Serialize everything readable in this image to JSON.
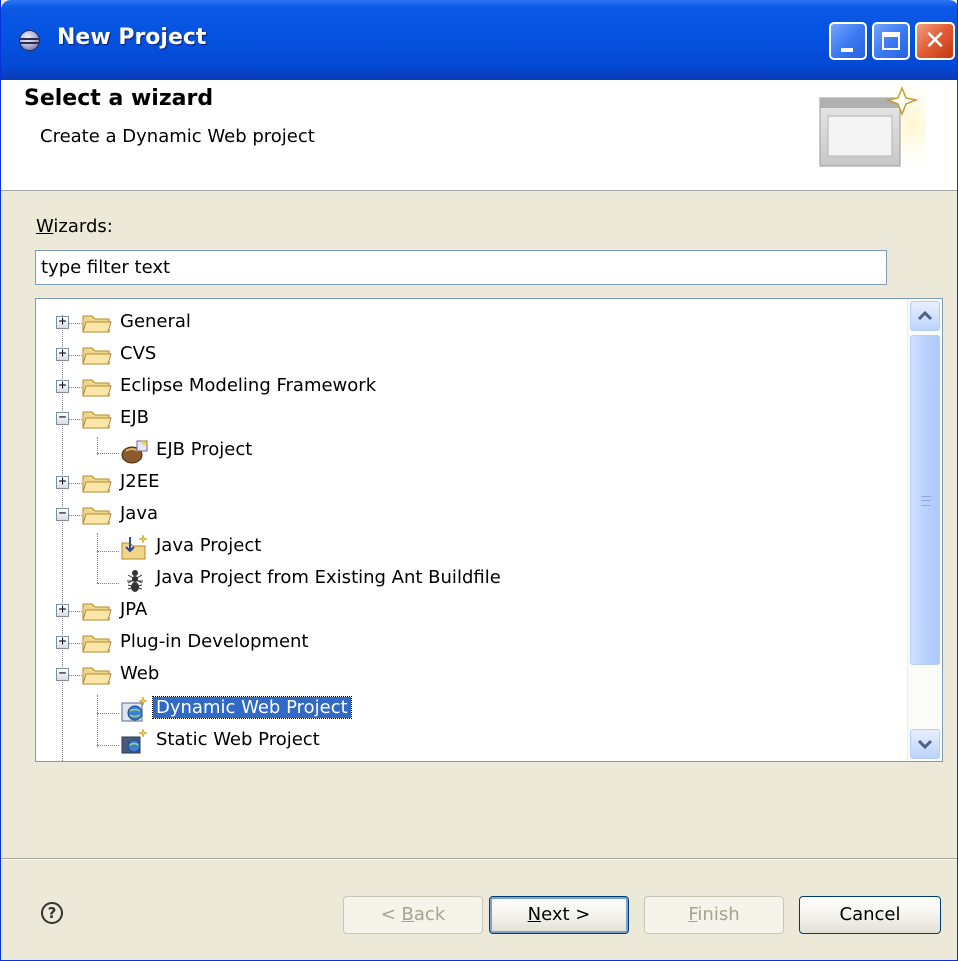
{
  "window": {
    "title": "New Project"
  },
  "header": {
    "title": "Select a wizard",
    "subtitle": "Create a Dynamic Web project"
  },
  "wizards": {
    "label_mnemonic": "W",
    "label_rest": "izards:",
    "filter_value": "type filter text"
  },
  "tree": {
    "general": "General",
    "cvs": "CVS",
    "emf": "Eclipse Modeling Framework",
    "ejb": "EJB",
    "ejb_project": "EJB Project",
    "j2ee": "J2EE",
    "java": "Java",
    "java_project": "Java Project",
    "java_ant": "Java Project from Existing Ant Buildfile",
    "jpa": "JPA",
    "plugin": "Plug-in Development",
    "web": "Web",
    "dynamic_web": "Dynamic Web Project",
    "static_web": "Static Web Project",
    "expand_symbol": "+",
    "collapse_symbol": "−"
  },
  "buttons": {
    "help": "?",
    "back_pre": "< ",
    "back_mn": "B",
    "back_post": "ack",
    "next_mn": "N",
    "next_post": "ext >",
    "finish_mn": "F",
    "finish_post": "inish",
    "cancel": "Cancel"
  },
  "colors": {
    "titlebar": "#0553e1",
    "selection": "#316ac5",
    "dialog_bg": "#ece9d8"
  }
}
